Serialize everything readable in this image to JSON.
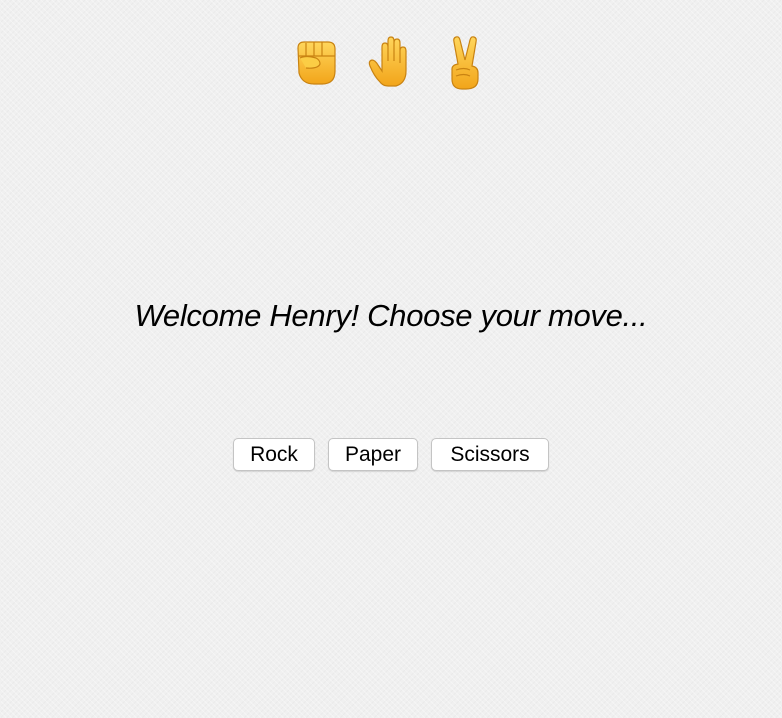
{
  "header": {
    "icons": [
      "raised-fist-icon",
      "raised-hand-icon",
      "victory-hand-icon"
    ]
  },
  "main": {
    "welcome_message": "Welcome Henry! Choose your move..."
  },
  "moves": {
    "rock_label": "Rock",
    "paper_label": "Paper",
    "scissors_label": "Scissors"
  },
  "colors": {
    "background": "#f0f0f0",
    "emoji_skin": "#f9c33b",
    "button_background": "#ffffff",
    "button_border": "#c4c4c4"
  }
}
